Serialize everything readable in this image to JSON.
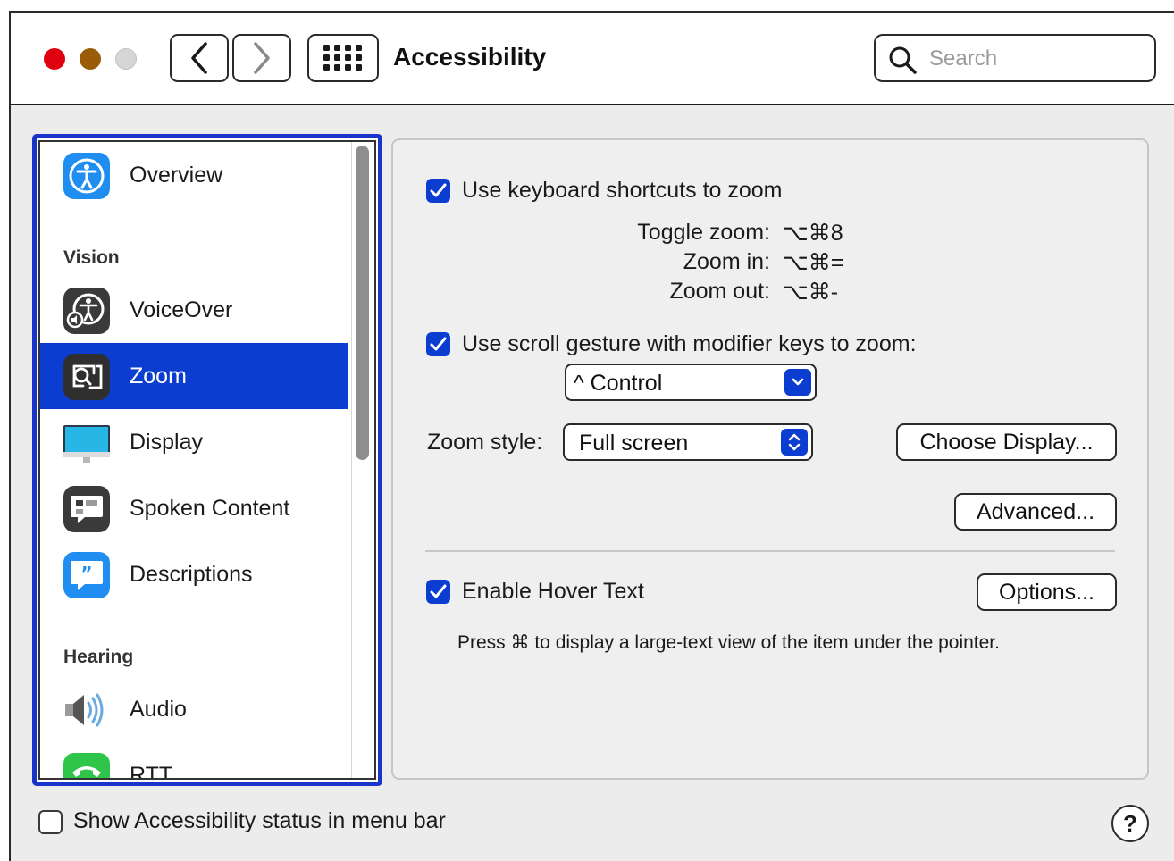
{
  "window": {
    "title": "Accessibility",
    "search_placeholder": "Search"
  },
  "sidebar": {
    "items": [
      {
        "label": "Overview",
        "icon": "accessibility-icon"
      },
      {
        "section": "Vision"
      },
      {
        "label": "VoiceOver",
        "icon": "voiceover-icon"
      },
      {
        "label": "Zoom",
        "icon": "zoom-icon",
        "selected": true
      },
      {
        "label": "Display",
        "icon": "display-icon"
      },
      {
        "label": "Spoken Content",
        "icon": "spoken-content-icon"
      },
      {
        "label": "Descriptions",
        "icon": "descriptions-icon"
      },
      {
        "section": "Hearing"
      },
      {
        "label": "Audio",
        "icon": "speaker-icon"
      },
      {
        "label": "RTT",
        "icon": "phone-icon"
      }
    ]
  },
  "zoom": {
    "keyboard_shortcuts": {
      "label": "Use keyboard shortcuts to zoom",
      "checked": true
    },
    "shortcuts": [
      {
        "name": "Toggle zoom:",
        "keys": "⌥⌘8"
      },
      {
        "name": "Zoom in:",
        "keys": "⌥⌘="
      },
      {
        "name": "Zoom out:",
        "keys": "⌥⌘-"
      }
    ],
    "scroll_gesture": {
      "label": "Use scroll gesture with modifier keys to zoom:",
      "checked": true
    },
    "modifier_value": "^ Control",
    "zoom_style_label": "Zoom style:",
    "zoom_style_value": "Full screen",
    "choose_display_button": "Choose Display...",
    "advanced_button": "Advanced...",
    "hover_text": {
      "label": "Enable Hover Text",
      "checked": true
    },
    "options_button": "Options...",
    "hover_hint": "Press ⌘ to display a large-text view of the item under the pointer."
  },
  "footer": {
    "status_menu_label": "Show Accessibility status in menu bar",
    "status_menu_checked": false,
    "help_label": "?"
  },
  "colors": {
    "accent": "#0b3dd1",
    "close": "#e0000f",
    "minimize": "#9a5c08"
  }
}
